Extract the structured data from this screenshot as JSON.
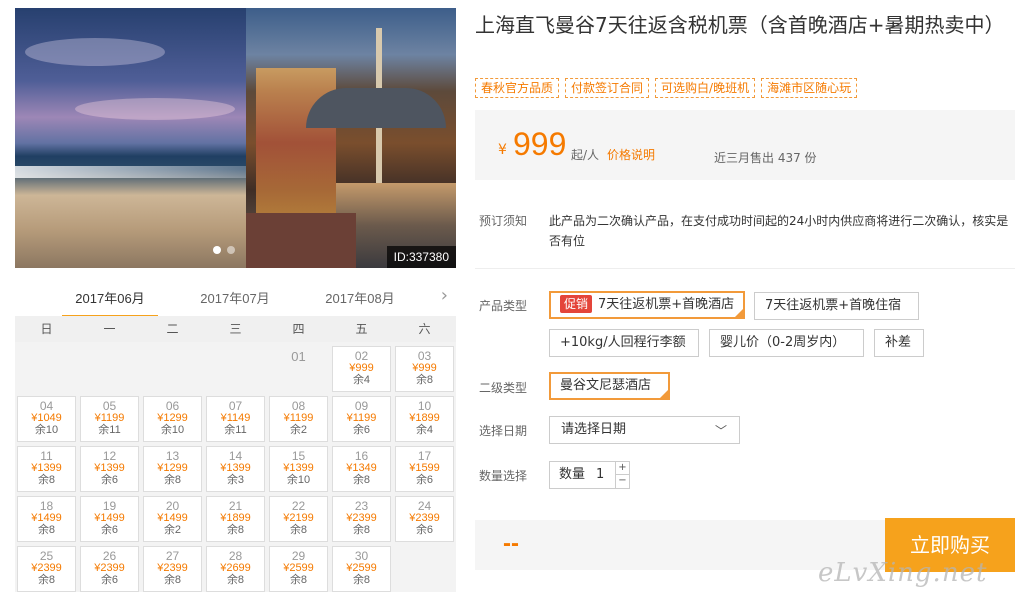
{
  "gallery": {
    "id_label": "ID:337380",
    "dots": 2,
    "active_dot": 0
  },
  "calendar": {
    "tabs": [
      "2017年06月",
      "2017年07月",
      "2017年08月"
    ],
    "active_tab": 0,
    "next_arrow": "chevron-right-icon",
    "weekdays": [
      "日",
      "一",
      "二",
      "三",
      "四",
      "五",
      "六"
    ],
    "weeks": [
      [
        null,
        null,
        null,
        null,
        {
          "d": "01"
        },
        {
          "d": "02",
          "p": "¥999",
          "r": "余4"
        },
        {
          "d": "03",
          "p": "¥999",
          "r": "余8"
        }
      ],
      [
        {
          "d": "04",
          "p": "¥1049",
          "r": "余10"
        },
        {
          "d": "05",
          "p": "¥1199",
          "r": "余11"
        },
        {
          "d": "06",
          "p": "¥1299",
          "r": "余10"
        },
        {
          "d": "07",
          "p": "¥1149",
          "r": "余11"
        },
        {
          "d": "08",
          "p": "¥1199",
          "r": "余2"
        },
        {
          "d": "09",
          "p": "¥1199",
          "r": "余6"
        },
        {
          "d": "10",
          "p": "¥1899",
          "r": "余4"
        }
      ],
      [
        {
          "d": "11",
          "p": "¥1399",
          "r": "余8"
        },
        {
          "d": "12",
          "p": "¥1399",
          "r": "余6"
        },
        {
          "d": "13",
          "p": "¥1299",
          "r": "余8"
        },
        {
          "d": "14",
          "p": "¥1399",
          "r": "余3"
        },
        {
          "d": "15",
          "p": "¥1399",
          "r": "余10"
        },
        {
          "d": "16",
          "p": "¥1349",
          "r": "余8"
        },
        {
          "d": "17",
          "p": "¥1599",
          "r": "余6"
        }
      ],
      [
        {
          "d": "18",
          "p": "¥1499",
          "r": "余8"
        },
        {
          "d": "19",
          "p": "¥1499",
          "r": "余6"
        },
        {
          "d": "20",
          "p": "¥1499",
          "r": "余2"
        },
        {
          "d": "21",
          "p": "¥1899",
          "r": "余8"
        },
        {
          "d": "22",
          "p": "¥2199",
          "r": "余8"
        },
        {
          "d": "23",
          "p": "¥2399",
          "r": "余8"
        },
        {
          "d": "24",
          "p": "¥2399",
          "r": "余6"
        }
      ],
      [
        {
          "d": "25",
          "p": "¥2399",
          "r": "余8"
        },
        {
          "d": "26",
          "p": "¥2399",
          "r": "余6"
        },
        {
          "d": "27",
          "p": "¥2399",
          "r": "余8"
        },
        {
          "d": "28",
          "p": "¥2699",
          "r": "余8"
        },
        {
          "d": "29",
          "p": "¥2599",
          "r": "余8"
        },
        {
          "d": "30",
          "p": "¥2599",
          "r": "余8"
        },
        null
      ]
    ]
  },
  "product": {
    "title": "上海直飞曼谷7天往返含税机票（含首晚酒店+暑期热卖中）",
    "tags": [
      "春秋官方品质",
      "付款签订合同",
      "可选购白/晚班机",
      "海滩市区随心玩"
    ],
    "price_currency": "¥",
    "price": "999",
    "price_unit": "起/人",
    "price_note": "价格说明",
    "sold": "近三月售出 437 份"
  },
  "booking": {
    "notice_label": "预订须知",
    "notice_text": "此产品为二次确认产品，在支付成功时间起的24小时内供应商将进行二次确认，核实是否有位",
    "type_label": "产品类型",
    "promo_badge": "促销",
    "types": [
      "7天往返机票+首晚酒店",
      "7天往返机票+首晚住宿",
      "+10kg/人回程行李额",
      "婴儿价（0-2周岁内）",
      "补差"
    ],
    "selected_type": 0,
    "subtype_label": "二级类型",
    "subtypes": [
      "曼谷文尼瑟酒店"
    ],
    "date_label": "选择日期",
    "date_placeholder": "请选择日期",
    "qty_label": "数量选择",
    "qty_prefix": "数量",
    "qty_value": "1",
    "total": "--",
    "buy_label": "立即购买"
  },
  "watermark": "eLvXing.net",
  "colors": {
    "accent": "#f6a21c",
    "price": "#f57a00",
    "promo": "#e4453a"
  }
}
